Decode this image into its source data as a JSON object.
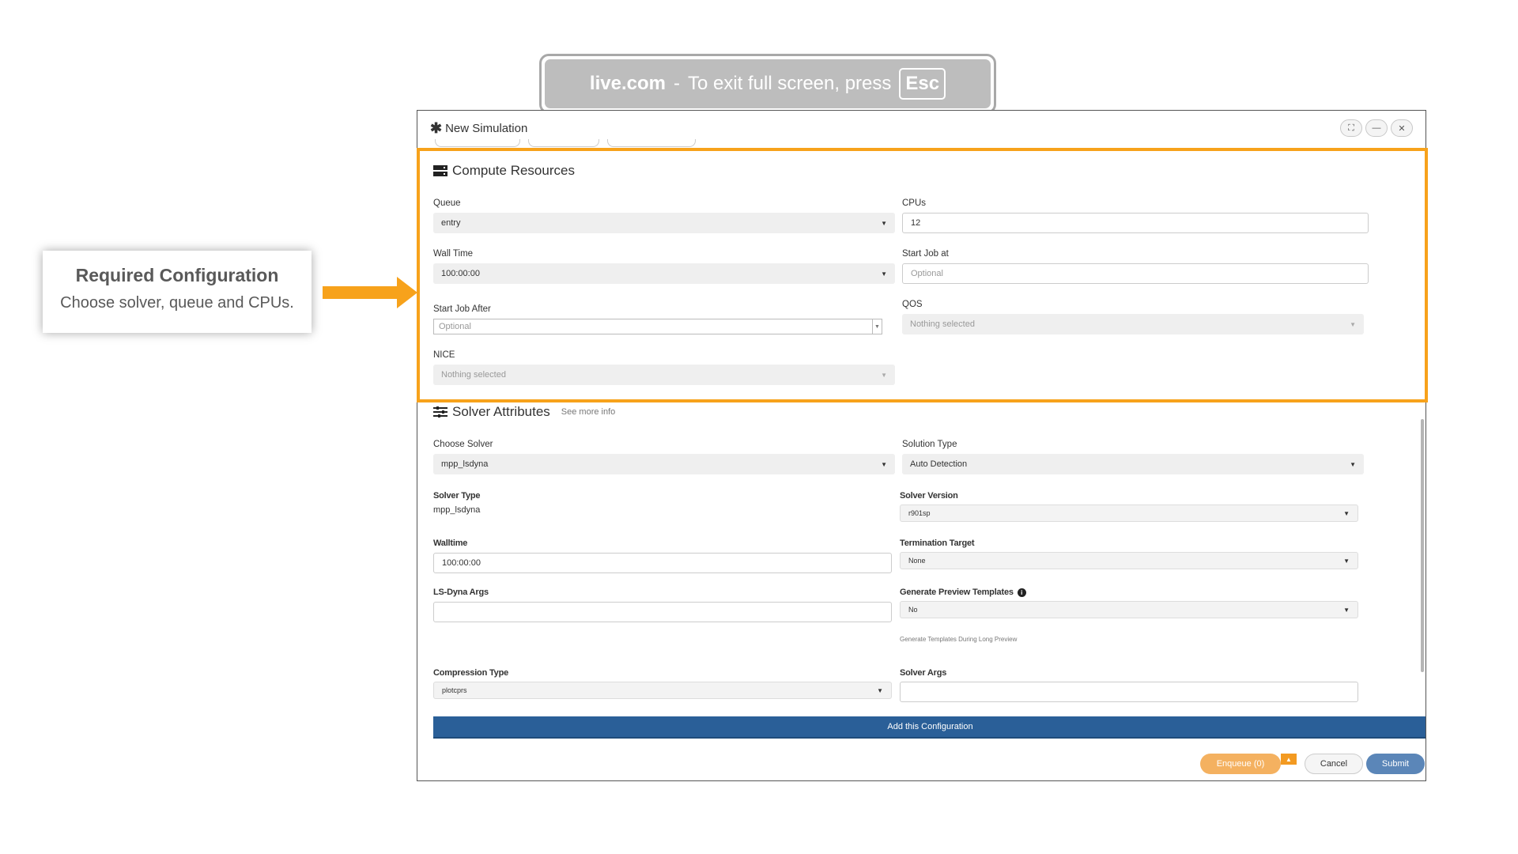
{
  "fullscreen_notice": {
    "site": "live.com",
    "separator": "-",
    "message": "To exit full screen, press",
    "key": "Esc"
  },
  "callout": {
    "title": "Required Configuration",
    "subtitle": "Choose solver, queue and CPUs."
  },
  "dialog": {
    "title": "New Simulation",
    "icons": {
      "title": "asterisk-icon",
      "buttons": [
        "expand-icon",
        "minimize-icon",
        "close-icon"
      ]
    }
  },
  "compute": {
    "heading": "Compute Resources",
    "icon": "server-icon",
    "queue": {
      "label": "Queue",
      "value": "entry"
    },
    "cpus": {
      "label": "CPUs",
      "value": "12"
    },
    "wall_time": {
      "label": "Wall Time",
      "value": "100:00:00"
    },
    "start_job_at": {
      "label": "Start Job at",
      "placeholder": "Optional"
    },
    "start_job_after": {
      "label": "Start Job After",
      "placeholder": "Optional"
    },
    "qos": {
      "label": "QOS",
      "value": "Nothing selected"
    },
    "nice": {
      "label": "NICE",
      "value": "Nothing selected"
    }
  },
  "solver": {
    "heading": "Solver Attributes",
    "icon": "sliders-icon",
    "more_link": "See more info",
    "choose_solver": {
      "label": "Choose Solver",
      "value": "mpp_lsdyna"
    },
    "solution_type": {
      "label": "Solution Type",
      "value": "Auto Detection"
    },
    "solver_type": {
      "label": "Solver Type",
      "value": "mpp_lsdyna"
    },
    "solver_version": {
      "label": "Solver Version",
      "value": "r901sp"
    },
    "walltime": {
      "label": "Walltime",
      "value": "100:00:00"
    },
    "termination_target": {
      "label": "Termination Target",
      "value": "None"
    },
    "lsdyna_args": {
      "label": "LS-Dyna Args",
      "value": ""
    },
    "generate_preview": {
      "label": "Generate Preview Templates",
      "value": "No",
      "hint": "Generate Templates During Long Preview",
      "info_icon": "info-icon"
    },
    "compression_type": {
      "label": "Compression Type",
      "value": "plotcprs"
    },
    "solver_args": {
      "label": "Solver Args",
      "value": ""
    },
    "add_button": "Add this Configuration"
  },
  "footer": {
    "enqueue": "Enqueue (0)",
    "cancel": "Cancel",
    "submit": "Submit"
  },
  "colors": {
    "highlight": "#f7a21b",
    "primary": "#2a5f98",
    "enqueue": "#f4b160",
    "submit": "#5b86b8"
  }
}
